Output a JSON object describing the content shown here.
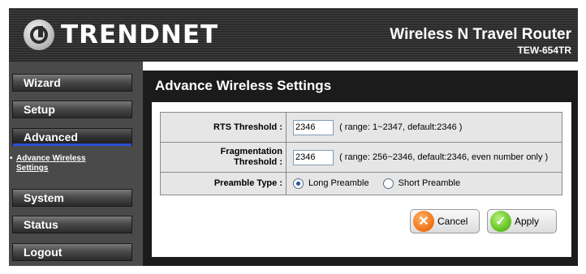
{
  "header": {
    "brand": "TRENDNET",
    "product_title": "Wireless N Travel Router",
    "model": "TEW-654TR"
  },
  "sidebar": {
    "items": [
      {
        "label": "Wizard",
        "active": false
      },
      {
        "label": "Setup",
        "active": false
      },
      {
        "label": "Advanced",
        "active": true
      },
      {
        "label": "System",
        "active": false
      },
      {
        "label": "Status",
        "active": false
      },
      {
        "label": "Logout",
        "active": false
      }
    ],
    "subitem": {
      "line1": "Advance Wireless",
      "line2": "Settings",
      "bullet": "•"
    }
  },
  "main": {
    "title": "Advance Wireless Settings",
    "rows": [
      {
        "label": "RTS Threshold :",
        "value": "2346",
        "hint": "( range: 1~2347, default:2346 )"
      },
      {
        "label_line1": "Fragmentation",
        "label_line2": "Threshold :",
        "value": "2346",
        "hint": "( range: 256~2346, default:2346, even number only )"
      },
      {
        "label": "Preamble Type :",
        "options": [
          "Long Preamble",
          "Short Preamble"
        ],
        "selected": "Long Preamble"
      }
    ],
    "buttons": {
      "cancel": "Cancel",
      "apply": "Apply"
    }
  },
  "colors": {
    "accent": "#2a4fd6",
    "cancel_icon": "#f07010",
    "apply_icon": "#5cbf1c"
  }
}
